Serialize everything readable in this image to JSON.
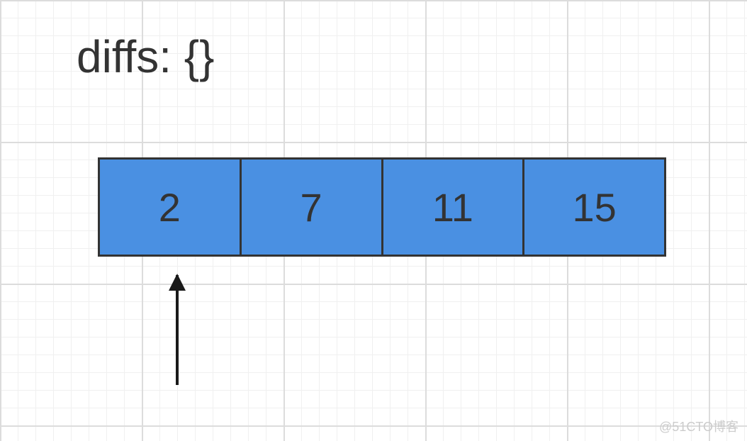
{
  "diffs_label": "diffs: {}",
  "array": {
    "cells": [
      "2",
      "7",
      "11",
      "15"
    ],
    "pointer_index": 0
  },
  "cell_color": "#4a90e2",
  "border_color": "#333333",
  "watermark": "@51CTO博客"
}
